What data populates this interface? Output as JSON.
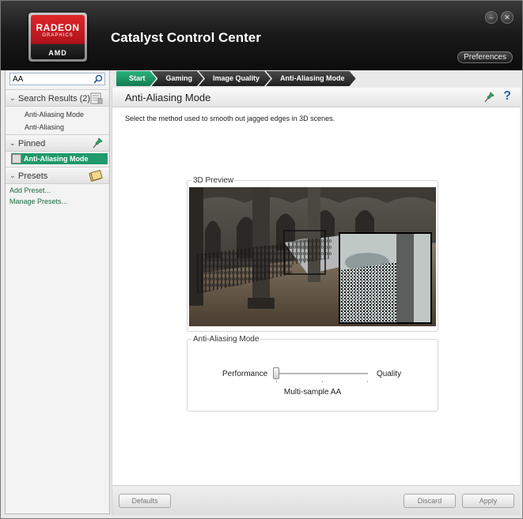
{
  "app": {
    "title": "Catalyst Control Center",
    "logo": {
      "line1": "RADEON",
      "line2": "GRAPHICS",
      "brand": "AMD"
    },
    "preferences_label": "Preferences",
    "minimize_label": "–",
    "close_label": "✕"
  },
  "sidebar": {
    "search": {
      "value": "AA",
      "placeholder": ""
    },
    "search_results": {
      "label": "Search Results (2)",
      "items": [
        "Anti-Aliasing Mode",
        "Anti-Aliasing"
      ]
    },
    "pinned": {
      "label": "Pinned",
      "items": [
        "Anti-Aliasing Mode"
      ]
    },
    "presets": {
      "label": "Presets",
      "links": [
        "Add Preset...",
        "Manage Presets..."
      ]
    }
  },
  "breadcrumb": [
    "Start",
    "Gaming",
    "Image Quality",
    "Anti-Aliasing Mode"
  ],
  "page": {
    "title": "Anti-Aliasing Mode",
    "help_label": "?",
    "description": "Select the method used to smooth out jagged edges in 3D scenes.",
    "preview_group_label": "3D Preview",
    "aa_group_label": "Anti-Aliasing Mode",
    "slider": {
      "left_label": "Performance",
      "right_label": "Quality",
      "value_label": "Multi-sample AA",
      "position": 0
    }
  },
  "footer": {
    "defaults_label": "Defaults",
    "discard_label": "Discard",
    "apply_label": "Apply"
  },
  "colors": {
    "accent_green": "#1f9a6a",
    "header_dark": "#1b1b1b",
    "link_green": "#1c6a41"
  }
}
